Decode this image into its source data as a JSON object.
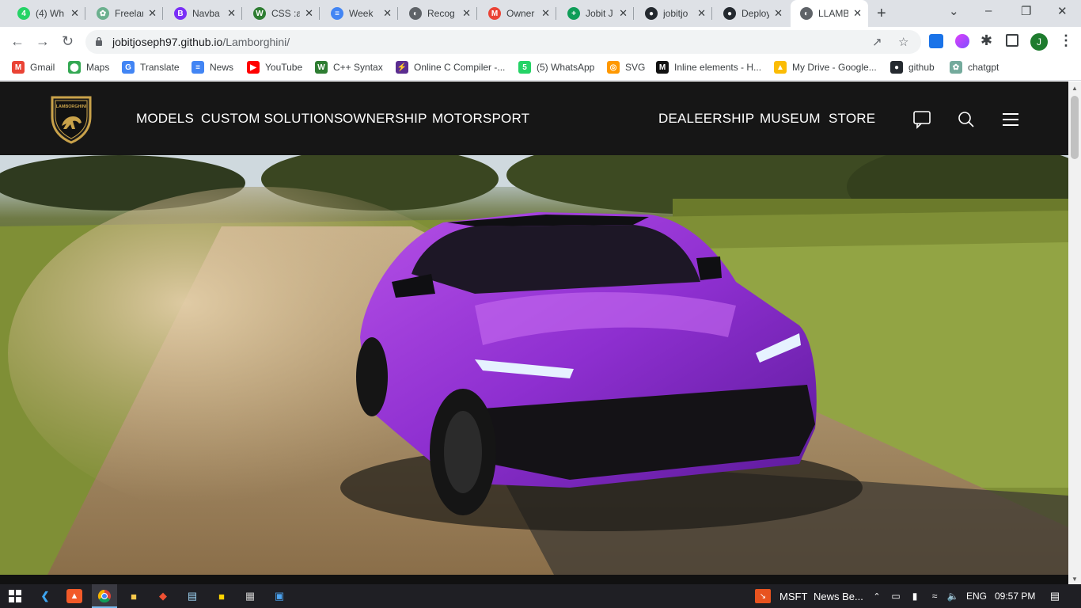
{
  "browser": {
    "tabs": [
      {
        "title": "(4) Wh",
        "favicon_color": "#25d366",
        "favicon_glyph": "4"
      },
      {
        "title": "Freelar",
        "favicon_color": "#6bb08e",
        "favicon_glyph": "✿"
      },
      {
        "title": "Navba",
        "favicon_color": "#7a2ff7",
        "favicon_glyph": "B"
      },
      {
        "title": "CSS :a",
        "favicon_color": "#2e7d32",
        "favicon_glyph": "W"
      },
      {
        "title": "Week",
        "favicon_color": "#4285f4",
        "favicon_glyph": "≡"
      },
      {
        "title": "Recog",
        "favicon_color": "#5f6368",
        "favicon_glyph": "◐"
      },
      {
        "title": "Owner",
        "favicon_color": "#ea4335",
        "favicon_glyph": "M"
      },
      {
        "title": "Jobit J",
        "favicon_color": "#0f9d58",
        "favicon_glyph": "+"
      },
      {
        "title": "jobitjo",
        "favicon_color": "#24292f",
        "favicon_glyph": "●"
      },
      {
        "title": "Deploy",
        "favicon_color": "#24292f",
        "favicon_glyph": "●"
      },
      {
        "title": "LLAMB",
        "favicon_color": "#5f6368",
        "favicon_glyph": "◐"
      }
    ],
    "active_tab_index": 10,
    "new_tab_glyph": "+",
    "url_host": "jobitjoseph97.github.io",
    "url_path": "/Lamborghini/",
    "window_controls": [
      "⌄",
      "–",
      "❐",
      "✕"
    ]
  },
  "bookmarks": [
    {
      "label": "Gmail",
      "icon": "gmail-icon",
      "color": "#ea4335",
      "glyph": "M"
    },
    {
      "label": "Maps",
      "icon": "maps-icon",
      "color": "#34a853",
      "glyph": "⬤"
    },
    {
      "label": "Translate",
      "icon": "translate-icon",
      "color": "#4285f4",
      "glyph": "G"
    },
    {
      "label": "News",
      "icon": "news-icon",
      "color": "#4285f4",
      "glyph": "≡"
    },
    {
      "label": "YouTube",
      "icon": "youtube-icon",
      "color": "#ff0000",
      "glyph": "▶"
    },
    {
      "label": "C++ Syntax",
      "icon": "w3-icon",
      "color": "#2e7d32",
      "glyph": "W"
    },
    {
      "label": "Online C Compiler -...",
      "icon": "compiler-icon",
      "color": "#5b2d90",
      "glyph": "⚡"
    },
    {
      "label": "(5) WhatsApp",
      "icon": "whatsapp-icon",
      "color": "#25d366",
      "glyph": "5"
    },
    {
      "label": "SVG",
      "icon": "svg-icon",
      "color": "#ff9800",
      "glyph": "◎"
    },
    {
      "label": "Inline elements - H...",
      "icon": "mdn-icon",
      "color": "#111111",
      "glyph": "M"
    },
    {
      "label": "My Drive - Google...",
      "icon": "drive-icon",
      "color": "#fbbc04",
      "glyph": "▲"
    },
    {
      "label": "github",
      "icon": "github-icon",
      "color": "#24292f",
      "glyph": "●"
    },
    {
      "label": "chatgpt",
      "icon": "chatgpt-icon",
      "color": "#74aa9c",
      "glyph": "✿"
    }
  ],
  "site": {
    "logo_text": "LAMBORGHINI",
    "nav_left": [
      "MODELS",
      "CUSTOM SOLUTIONS",
      "OWNERSHIP",
      "MOTORSPORT"
    ],
    "nav_right": [
      "DEALEERSHIP",
      "MUSEUM",
      "STORE"
    ],
    "hero_subject": "Purple Lamborghini Urus driving on a dusty dirt road"
  },
  "taskbar": {
    "apps": [
      "windows-start-icon",
      "vscode-icon",
      "brave-icon",
      "chrome-icon",
      "file-explorer-icon",
      "git-icon",
      "notepad-icon",
      "sticky-notes-icon",
      "calculator-icon",
      "photos-icon"
    ],
    "stock_ticker": "MSFT",
    "news_text": "News Be...",
    "language": "ENG",
    "time": "09:57 PM"
  }
}
